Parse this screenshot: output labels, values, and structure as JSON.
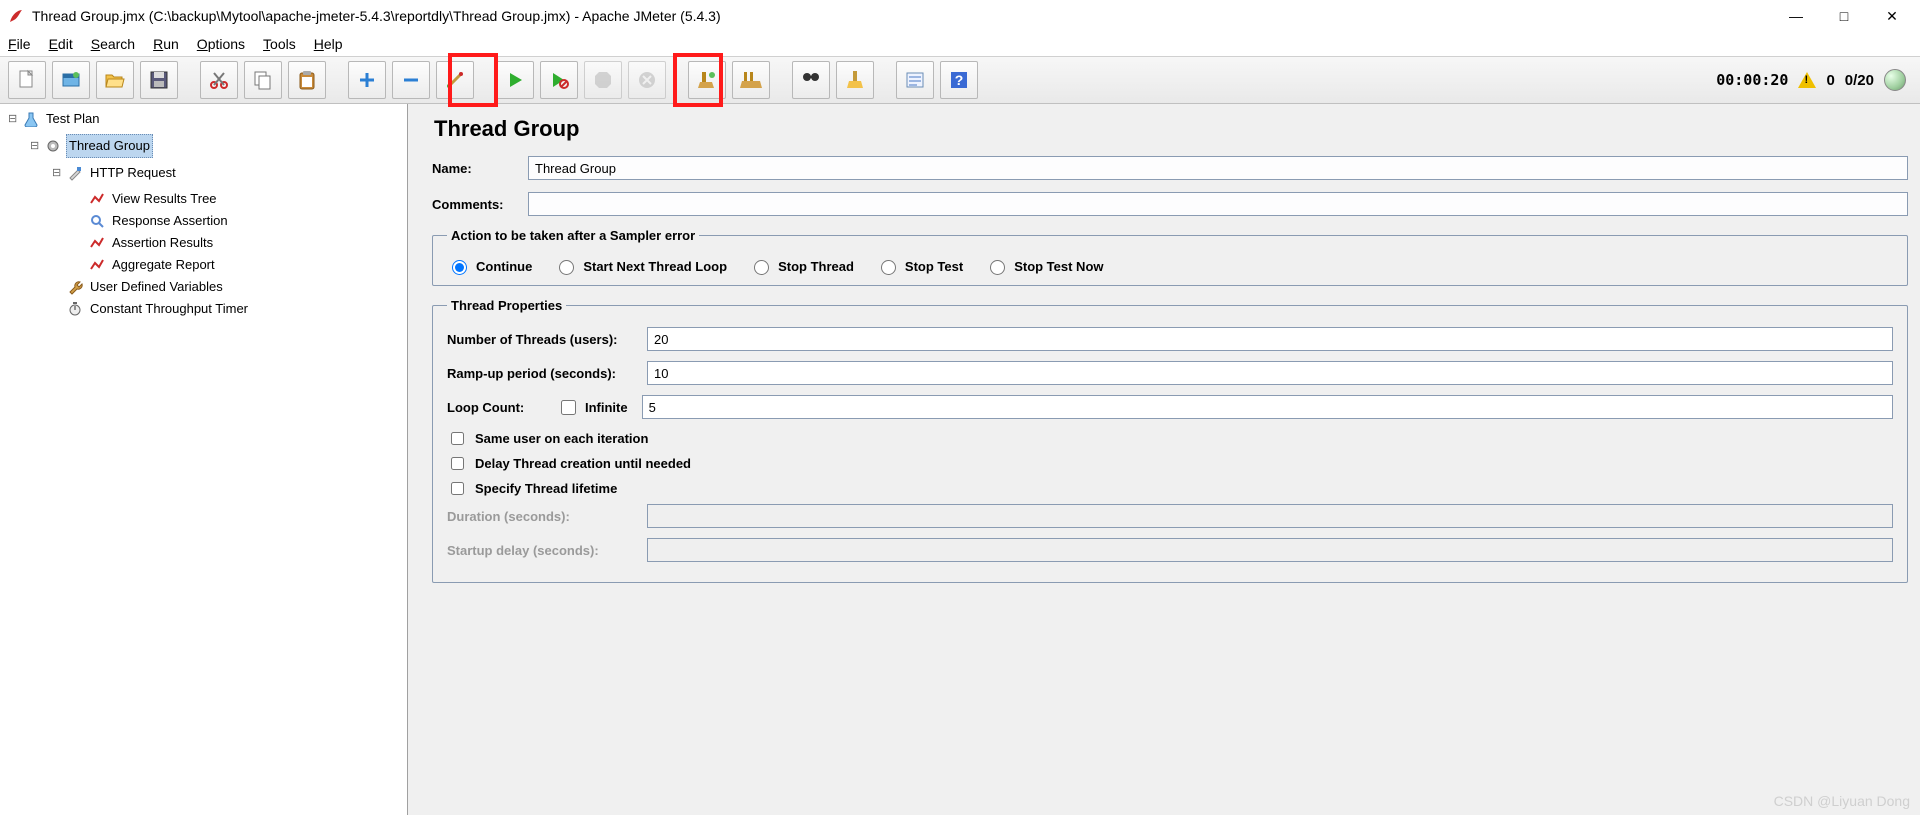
{
  "window": {
    "title": "Thread Group.jmx (C:\\backup\\Mytool\\apache-jmeter-5.4.3\\reportdly\\Thread Group.jmx) - Apache JMeter (5.4.3)",
    "minimize": "—",
    "maximize": "□",
    "close": "✕"
  },
  "menu": {
    "file": "File",
    "edit": "Edit",
    "search": "Search",
    "run": "Run",
    "options": "Options",
    "tools": "Tools",
    "help": "Help"
  },
  "toolbar_icons": {
    "new": "new-icon",
    "templates": "templates-icon",
    "open": "open-icon",
    "save": "save-icon",
    "cut": "cut-icon",
    "copy": "copy-icon",
    "paste": "paste-icon",
    "add": "plus-icon",
    "remove": "minus-icon",
    "wand": "wand-icon",
    "start": "start-icon",
    "start_no_pauses": "start-no-pauses-icon",
    "stop": "stop-icon",
    "shutdown": "shutdown-icon",
    "broom1": "broom-icon",
    "broom2": "broom-all-icon",
    "binoculars": "binoculars-icon",
    "brush": "clear-icon",
    "list": "toggle-log-icon",
    "help": "help-icon"
  },
  "status": {
    "time": "00:00:20",
    "warning_count": "0",
    "active_threads": "0/20"
  },
  "tree": {
    "test_plan": "Test Plan",
    "thread_group": "Thread Group",
    "http_request": "HTTP Request",
    "view_results_tree": "View Results Tree",
    "response_assertion": "Response Assertion",
    "assertion_results": "Assertion Results",
    "aggregate_report": "Aggregate Report",
    "user_defined_variables": "User Defined Variables",
    "constant_throughput_timer": "Constant Throughput Timer"
  },
  "editor": {
    "title": "Thread Group",
    "name_label": "Name:",
    "name_value": "Thread Group",
    "comments_label": "Comments:",
    "comments_value": "",
    "action_legend": "Action to be taken after a Sampler error",
    "actions": {
      "continue": "Continue",
      "start_next": "Start Next Thread Loop",
      "stop_thread": "Stop Thread",
      "stop_test": "Stop Test",
      "stop_test_now": "Stop Test Now"
    },
    "props_legend": "Thread Properties",
    "num_threads_label": "Number of Threads (users):",
    "num_threads_value": "20",
    "ramp_up_label": "Ramp-up period (seconds):",
    "ramp_up_value": "10",
    "loop_count_label": "Loop Count:",
    "infinite_label": "Infinite",
    "loop_count_value": "5",
    "same_user_label": "Same user on each iteration",
    "delay_creation_label": "Delay Thread creation until needed",
    "lifetime_label": "Specify Thread lifetime",
    "duration_label": "Duration (seconds):",
    "duration_value": "",
    "startup_delay_label": "Startup delay (seconds):",
    "startup_delay_value": ""
  },
  "watermark": "CSDN @Liyuan Dong"
}
